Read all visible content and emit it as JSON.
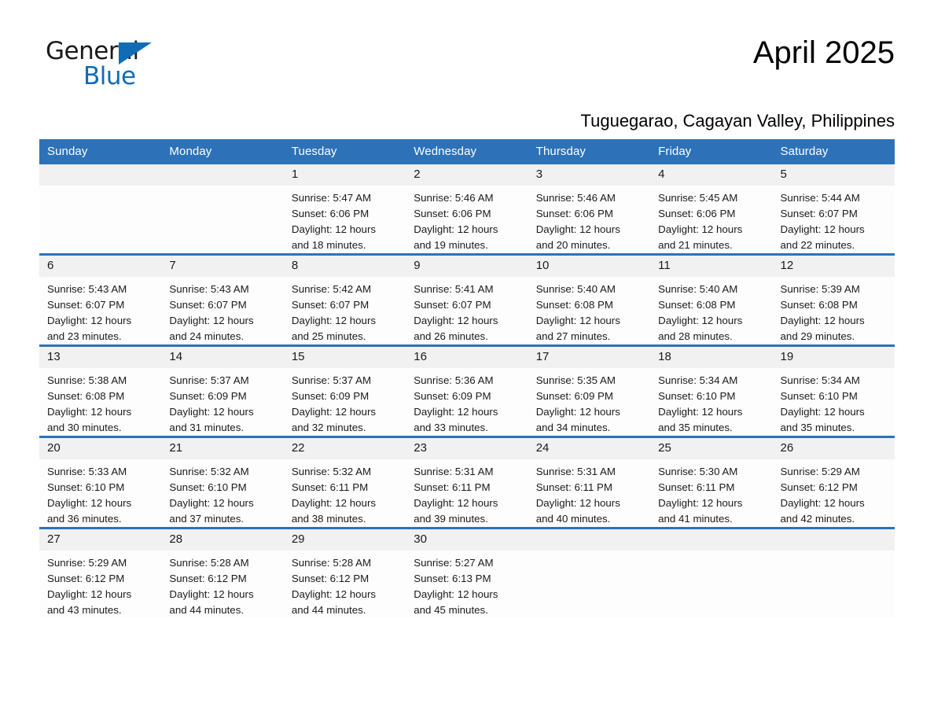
{
  "brand": {
    "name_part1": "General",
    "name_part2": "Blue",
    "triangle_color": "#0f6cb5"
  },
  "header": {
    "title": "April 2025",
    "subtitle": "Tuguegarao, Cagayan Valley, Philippines"
  },
  "theme": {
    "header_blue": "#2d72b8",
    "daynum_band": "#f1f1f1",
    "text": "#1a1a1a"
  },
  "calendar": {
    "weekday_headers": [
      "Sunday",
      "Monday",
      "Tuesday",
      "Wednesday",
      "Thursday",
      "Friday",
      "Saturday"
    ],
    "weeks": [
      [
        {
          "day": "",
          "sunrise": "",
          "sunset": "",
          "daylight_line1": "",
          "daylight_line2": ""
        },
        {
          "day": "",
          "sunrise": "",
          "sunset": "",
          "daylight_line1": "",
          "daylight_line2": ""
        },
        {
          "day": "1",
          "sunrise": "Sunrise: 5:47 AM",
          "sunset": "Sunset: 6:06 PM",
          "daylight_line1": "Daylight: 12 hours",
          "daylight_line2": "and 18 minutes."
        },
        {
          "day": "2",
          "sunrise": "Sunrise: 5:46 AM",
          "sunset": "Sunset: 6:06 PM",
          "daylight_line1": "Daylight: 12 hours",
          "daylight_line2": "and 19 minutes."
        },
        {
          "day": "3",
          "sunrise": "Sunrise: 5:46 AM",
          "sunset": "Sunset: 6:06 PM",
          "daylight_line1": "Daylight: 12 hours",
          "daylight_line2": "and 20 minutes."
        },
        {
          "day": "4",
          "sunrise": "Sunrise: 5:45 AM",
          "sunset": "Sunset: 6:06 PM",
          "daylight_line1": "Daylight: 12 hours",
          "daylight_line2": "and 21 minutes."
        },
        {
          "day": "5",
          "sunrise": "Sunrise: 5:44 AM",
          "sunset": "Sunset: 6:07 PM",
          "daylight_line1": "Daylight: 12 hours",
          "daylight_line2": "and 22 minutes."
        }
      ],
      [
        {
          "day": "6",
          "sunrise": "Sunrise: 5:43 AM",
          "sunset": "Sunset: 6:07 PM",
          "daylight_line1": "Daylight: 12 hours",
          "daylight_line2": "and 23 minutes."
        },
        {
          "day": "7",
          "sunrise": "Sunrise: 5:43 AM",
          "sunset": "Sunset: 6:07 PM",
          "daylight_line1": "Daylight: 12 hours",
          "daylight_line2": "and 24 minutes."
        },
        {
          "day": "8",
          "sunrise": "Sunrise: 5:42 AM",
          "sunset": "Sunset: 6:07 PM",
          "daylight_line1": "Daylight: 12 hours",
          "daylight_line2": "and 25 minutes."
        },
        {
          "day": "9",
          "sunrise": "Sunrise: 5:41 AM",
          "sunset": "Sunset: 6:07 PM",
          "daylight_line1": "Daylight: 12 hours",
          "daylight_line2": "and 26 minutes."
        },
        {
          "day": "10",
          "sunrise": "Sunrise: 5:40 AM",
          "sunset": "Sunset: 6:08 PM",
          "daylight_line1": "Daylight: 12 hours",
          "daylight_line2": "and 27 minutes."
        },
        {
          "day": "11",
          "sunrise": "Sunrise: 5:40 AM",
          "sunset": "Sunset: 6:08 PM",
          "daylight_line1": "Daylight: 12 hours",
          "daylight_line2": "and 28 minutes."
        },
        {
          "day": "12",
          "sunrise": "Sunrise: 5:39 AM",
          "sunset": "Sunset: 6:08 PM",
          "daylight_line1": "Daylight: 12 hours",
          "daylight_line2": "and 29 minutes."
        }
      ],
      [
        {
          "day": "13",
          "sunrise": "Sunrise: 5:38 AM",
          "sunset": "Sunset: 6:08 PM",
          "daylight_line1": "Daylight: 12 hours",
          "daylight_line2": "and 30 minutes."
        },
        {
          "day": "14",
          "sunrise": "Sunrise: 5:37 AM",
          "sunset": "Sunset: 6:09 PM",
          "daylight_line1": "Daylight: 12 hours",
          "daylight_line2": "and 31 minutes."
        },
        {
          "day": "15",
          "sunrise": "Sunrise: 5:37 AM",
          "sunset": "Sunset: 6:09 PM",
          "daylight_line1": "Daylight: 12 hours",
          "daylight_line2": "and 32 minutes."
        },
        {
          "day": "16",
          "sunrise": "Sunrise: 5:36 AM",
          "sunset": "Sunset: 6:09 PM",
          "daylight_line1": "Daylight: 12 hours",
          "daylight_line2": "and 33 minutes."
        },
        {
          "day": "17",
          "sunrise": "Sunrise: 5:35 AM",
          "sunset": "Sunset: 6:09 PM",
          "daylight_line1": "Daylight: 12 hours",
          "daylight_line2": "and 34 minutes."
        },
        {
          "day": "18",
          "sunrise": "Sunrise: 5:34 AM",
          "sunset": "Sunset: 6:10 PM",
          "daylight_line1": "Daylight: 12 hours",
          "daylight_line2": "and 35 minutes."
        },
        {
          "day": "19",
          "sunrise": "Sunrise: 5:34 AM",
          "sunset": "Sunset: 6:10 PM",
          "daylight_line1": "Daylight: 12 hours",
          "daylight_line2": "and 35 minutes."
        }
      ],
      [
        {
          "day": "20",
          "sunrise": "Sunrise: 5:33 AM",
          "sunset": "Sunset: 6:10 PM",
          "daylight_line1": "Daylight: 12 hours",
          "daylight_line2": "and 36 minutes."
        },
        {
          "day": "21",
          "sunrise": "Sunrise: 5:32 AM",
          "sunset": "Sunset: 6:10 PM",
          "daylight_line1": "Daylight: 12 hours",
          "daylight_line2": "and 37 minutes."
        },
        {
          "day": "22",
          "sunrise": "Sunrise: 5:32 AM",
          "sunset": "Sunset: 6:11 PM",
          "daylight_line1": "Daylight: 12 hours",
          "daylight_line2": "and 38 minutes."
        },
        {
          "day": "23",
          "sunrise": "Sunrise: 5:31 AM",
          "sunset": "Sunset: 6:11 PM",
          "daylight_line1": "Daylight: 12 hours",
          "daylight_line2": "and 39 minutes."
        },
        {
          "day": "24",
          "sunrise": "Sunrise: 5:31 AM",
          "sunset": "Sunset: 6:11 PM",
          "daylight_line1": "Daylight: 12 hours",
          "daylight_line2": "and 40 minutes."
        },
        {
          "day": "25",
          "sunrise": "Sunrise: 5:30 AM",
          "sunset": "Sunset: 6:11 PM",
          "daylight_line1": "Daylight: 12 hours",
          "daylight_line2": "and 41 minutes."
        },
        {
          "day": "26",
          "sunrise": "Sunrise: 5:29 AM",
          "sunset": "Sunset: 6:12 PM",
          "daylight_line1": "Daylight: 12 hours",
          "daylight_line2": "and 42 minutes."
        }
      ],
      [
        {
          "day": "27",
          "sunrise": "Sunrise: 5:29 AM",
          "sunset": "Sunset: 6:12 PM",
          "daylight_line1": "Daylight: 12 hours",
          "daylight_line2": "and 43 minutes."
        },
        {
          "day": "28",
          "sunrise": "Sunrise: 5:28 AM",
          "sunset": "Sunset: 6:12 PM",
          "daylight_line1": "Daylight: 12 hours",
          "daylight_line2": "and 44 minutes."
        },
        {
          "day": "29",
          "sunrise": "Sunrise: 5:28 AM",
          "sunset": "Sunset: 6:12 PM",
          "daylight_line1": "Daylight: 12 hours",
          "daylight_line2": "and 44 minutes."
        },
        {
          "day": "30",
          "sunrise": "Sunrise: 5:27 AM",
          "sunset": "Sunset: 6:13 PM",
          "daylight_line1": "Daylight: 12 hours",
          "daylight_line2": "and 45 minutes."
        },
        {
          "day": "",
          "sunrise": "",
          "sunset": "",
          "daylight_line1": "",
          "daylight_line2": ""
        },
        {
          "day": "",
          "sunrise": "",
          "sunset": "",
          "daylight_line1": "",
          "daylight_line2": ""
        },
        {
          "day": "",
          "sunrise": "",
          "sunset": "",
          "daylight_line1": "",
          "daylight_line2": ""
        }
      ]
    ]
  }
}
